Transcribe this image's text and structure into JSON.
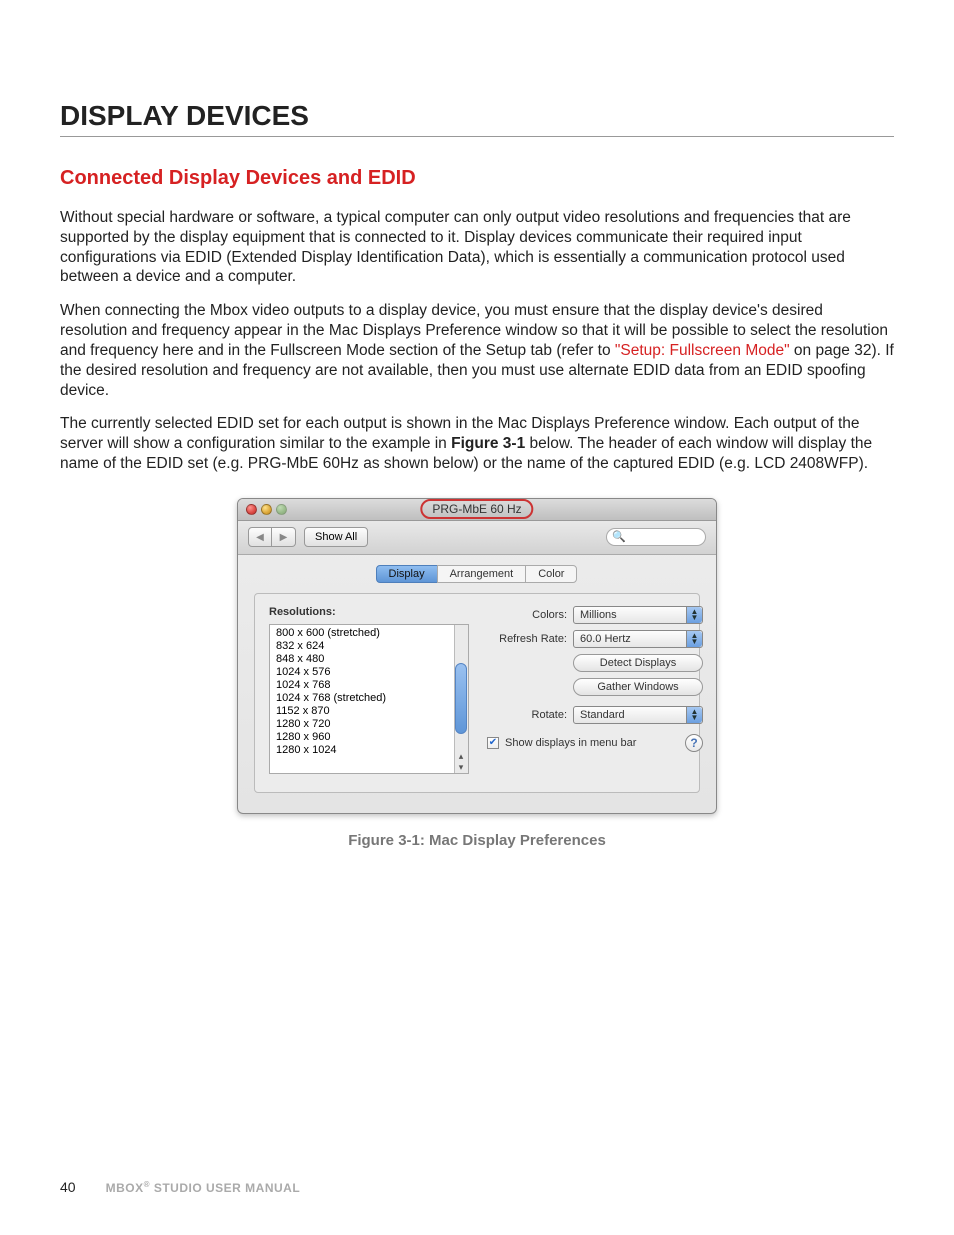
{
  "heading": "DISPLAY DEVICES",
  "subheading": "Connected Display Devices and EDID",
  "para1": "Without special hardware or software, a typical computer can only output video resolutions and frequencies that are supported by the display equipment that is connected to it. Display devices communicate their required input configurations via EDID (Extended Display Identification Data), which is essentially a communication protocol used between a device and a computer.",
  "para2_a": "When connecting the Mbox video outputs to a display device, you must ensure that the display device's desired resolution and frequency appear in the Mac Displays Preference window so that it will be possible to select the resolution and frequency here and in the Fullscreen Mode section of the Setup tab (refer to ",
  "para2_link": "\"Setup: Fullscreen Mode\"",
  "para2_b": " on page 32). If the desired resolution and frequency are not available, then you must use alternate EDID data from an EDID spoofing device.",
  "para3_a": "The currently selected EDID set for each output is shown in the Mac Displays Preference window. Each output of the server will show a configuration similar to the example in ",
  "para3_bold": "Figure 3-1",
  "para3_b": " below. The header of each window will display the name of the EDID set (e.g. PRG-MbE 60Hz as shown below) or the name of the captured EDID (e.g. LCD 2408WFP).",
  "window": {
    "title": "PRG-MbE 60 Hz",
    "show_all": "Show All",
    "tabs": [
      "Display",
      "Arrangement",
      "Color"
    ],
    "resolutions_label": "Resolutions:",
    "resolutions": [
      "800 x 600 (stretched)",
      "832 x 624",
      "848 x 480",
      "1024 x 576",
      "1024 x 768",
      "1024 x 768 (stretched)",
      "1152 x 870",
      "1280 x 720",
      "1280 x 960",
      "1280 x 1024"
    ],
    "colors_label": "Colors:",
    "colors_value": "Millions",
    "refresh_label": "Refresh Rate:",
    "refresh_value": "60.0 Hertz",
    "detect_btn": "Detect Displays",
    "gather_btn": "Gather Windows",
    "rotate_label": "Rotate:",
    "rotate_value": "Standard",
    "menubar_cb": "Show displays in menu bar"
  },
  "figure_caption": "Figure 3-1:  Mac Display Preferences",
  "page_number": "40",
  "footer_doc": "MBOX® STUDIO USER MANUAL"
}
